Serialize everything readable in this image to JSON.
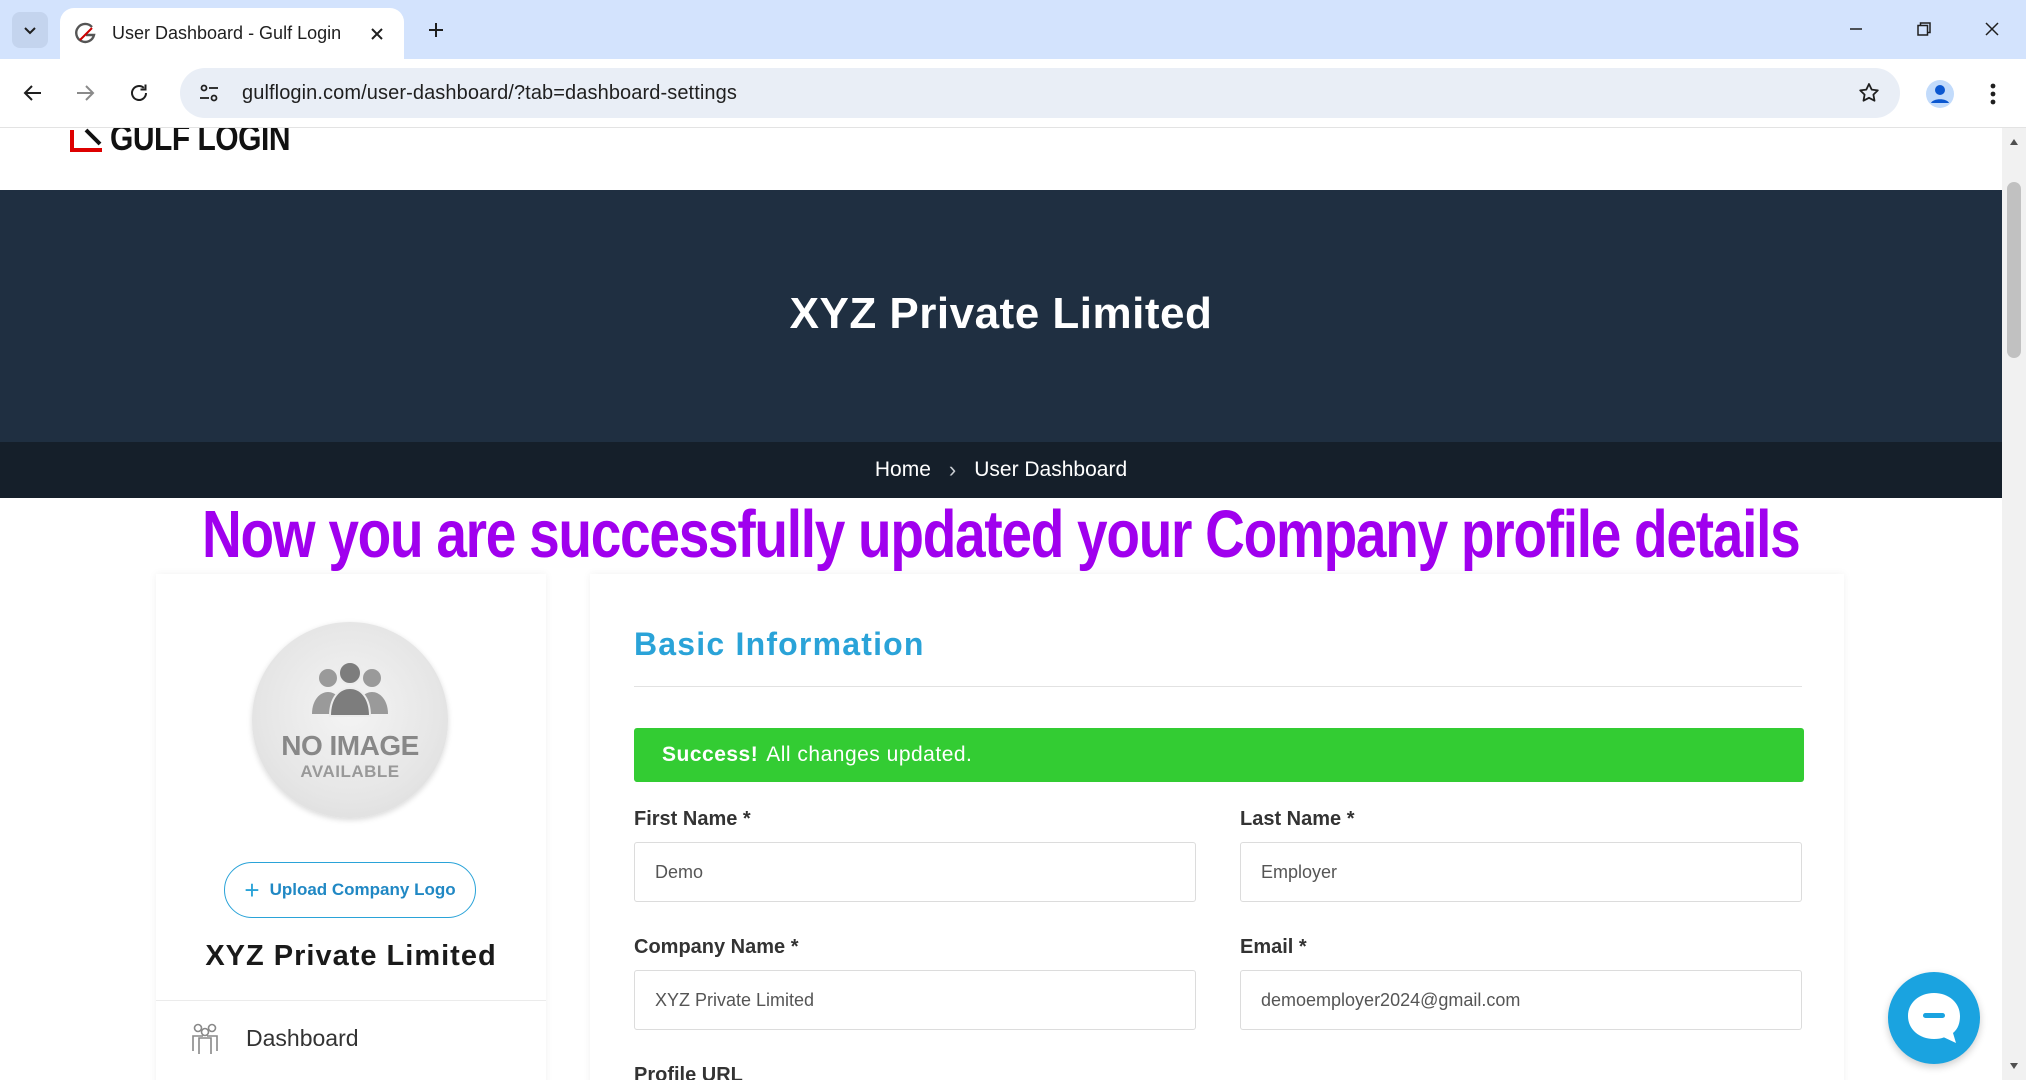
{
  "browser": {
    "tab_title": "User Dashboard - Gulf Login",
    "url": "gulflogin.com/user-dashboard/?tab=dashboard-settings"
  },
  "site": {
    "logo_text": "GULF LOGIN"
  },
  "hero": {
    "title": "XYZ Private Limited"
  },
  "breadcrumb": {
    "home": "Home",
    "separator": "›",
    "current": "User Dashboard"
  },
  "banner": {
    "text": "Now you are successfully updated your Company profile details",
    "color": "#a000ee"
  },
  "sidebar": {
    "no_image_line1": "NO IMAGE",
    "no_image_line2": "AVAILABLE",
    "upload_plus": "+",
    "upload_label": "Upload Company Logo",
    "company_name": "XYZ Private Limited",
    "items": [
      {
        "label": "Dashboard",
        "icon": "people-group-icon"
      }
    ]
  },
  "form": {
    "section_title": "Basic Information",
    "alert": {
      "strong": "Success!",
      "message": "All changes updated.",
      "color": "#33cc33"
    },
    "fields": {
      "first_name": {
        "label": "First Name *",
        "value": "Demo"
      },
      "last_name": {
        "label": "Last Name *",
        "value": "Employer"
      },
      "company_name": {
        "label": "Company Name *",
        "value": "XYZ Private Limited"
      },
      "email": {
        "label": "Email *",
        "value": "demoemployer2024@gmail.com"
      },
      "profile_url": {
        "label": "Profile URL"
      }
    }
  },
  "colors": {
    "hero_bg": "#1f2f41",
    "crumbbar_bg": "#151f2a",
    "accent": "#2aa3d8",
    "chat": "#1aa3e0"
  }
}
